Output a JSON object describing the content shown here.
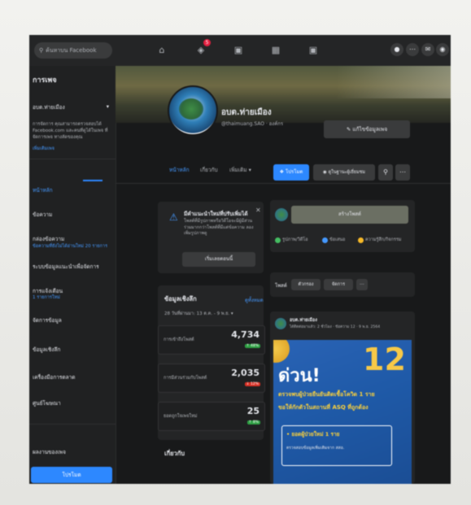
{
  "topbar": {
    "search_placeholder": "ค้นหาบน Facebook",
    "notification_count": "5"
  },
  "sidebar": {
    "title": "การเพจ",
    "page_name": "อบต.ท่ายเมือง",
    "intro": "การจัดการ คุณสามารถตรวจสอบได้ Facebook.com และคนที่ดูได้ในเพจ ที่จัดการเพจ ทางลัดของคุณ",
    "intro_link": "เพิ่มเติมเพจ",
    "items": [
      {
        "label": "หน้าหลัก"
      },
      {
        "label": "ข้อความ"
      },
      {
        "label": "กล่องข้อความ",
        "detail": "ข้อความที่ยังไม่ได้อ่านใหม่ 20 รายการ"
      },
      {
        "label": "ระบบข้อมูลแนะนำเพื่อจัดการ"
      },
      {
        "label": "การแจ้งเตือน",
        "detail": "1 รายการใหม่"
      },
      {
        "label": "จัดการข้อมูล"
      },
      {
        "label": "ข้อมูลเชิงลึก"
      },
      {
        "label": "เครื่องมือการตลาด"
      },
      {
        "label": "ศูนย์โฆษณา"
      },
      {
        "label": "ผลงานของเพจ"
      }
    ],
    "promote_button": "โปรโมต"
  },
  "header": {
    "page_name": "อบต.ท่ายเมือง",
    "handle": "@thaimuang.SAO · องค์กร",
    "edit_button": "แก้ไขข้อมูลเพจ"
  },
  "tabs": [
    {
      "label": "หน้าหลัก",
      "active": true
    },
    {
      "label": "เกี่ยวกับ",
      "active": false
    },
    {
      "label": "เพิ่มเติม ▾",
      "active": false
    }
  ],
  "actions": {
    "follow_button": "โปรโมต",
    "promote_button": "ดูในฐานะผู้เยี่ยมชม",
    "search_icon": "search-icon",
    "more_icon": "more-icon"
  },
  "notice": {
    "title": "มีคำแนะนำใหม่ที่ปรับเพิ่มได้",
    "body": "โพสต์ที่มีรูปภาพหรือวิดีโอจะมีผู้มีส่วนร่วมมากกว่าโพสต์ที่มีแต่ข้อความ ลองเพิ่มรูปภาพดู",
    "button": "เริ่มเลยตอนนี้"
  },
  "insights": {
    "title": "ข้อมูลเชิงลึก",
    "link": "ดูทั้งหมด",
    "period": "28 วันที่ผ่านมา: 13 ต.ค. - 9 พ.ย. ▾",
    "stats": [
      {
        "label": "การเข้าถึงโพสต์",
        "value": "4,734",
        "delta": "↑ 48%",
        "delta_color": "#2ea043"
      },
      {
        "label": "การมีส่วนร่วมกับโพสต์",
        "value": "2,035",
        "delta": "↓ 12%",
        "delta_color": "#d93025"
      },
      {
        "label": "ยอดถูกใจเพจใหม่",
        "value": "25",
        "delta": "↑ 8%",
        "delta_color": "#2ea043"
      }
    ]
  },
  "about": {
    "title": "เกี่ยวกับ"
  },
  "composer": {
    "input_label": "สร้างโพสต์",
    "options": [
      {
        "label": "รูปภาพ/วิดีโอ",
        "color": "#45bd62"
      },
      {
        "label": "ข้อเสนอ",
        "color": "#4599ff"
      },
      {
        "label": "ความรู้สึก/กิจกรรม",
        "color": "#f7b928"
      }
    ]
  },
  "filters": {
    "label": "โพสต์",
    "pills": [
      "ตัวกรอง",
      "จัดการ"
    ]
  },
  "post": {
    "author": "อบต.ท่ายเมือง",
    "meta": "ได้ติดต่อมาแล้ว: 2 ชั่วโมง · ข้อความ 12 · 9 พ.ย. 2564",
    "headline": "ด่วน!",
    "count": "12",
    "line1": "ตรวจพบผู้ป่วยยืนยันติดเชื้อโควิด 1 ราย",
    "line2": "ขอให้กักตัวในสถานที่ ASQ ที่ถูกต้อง",
    "box_line1": "• ยอดผู้ป่วยใหม่ 1 ราย",
    "box_line2": "ตรวจสอบข้อมูลเพิ่มเติมจาก สสอ."
  }
}
